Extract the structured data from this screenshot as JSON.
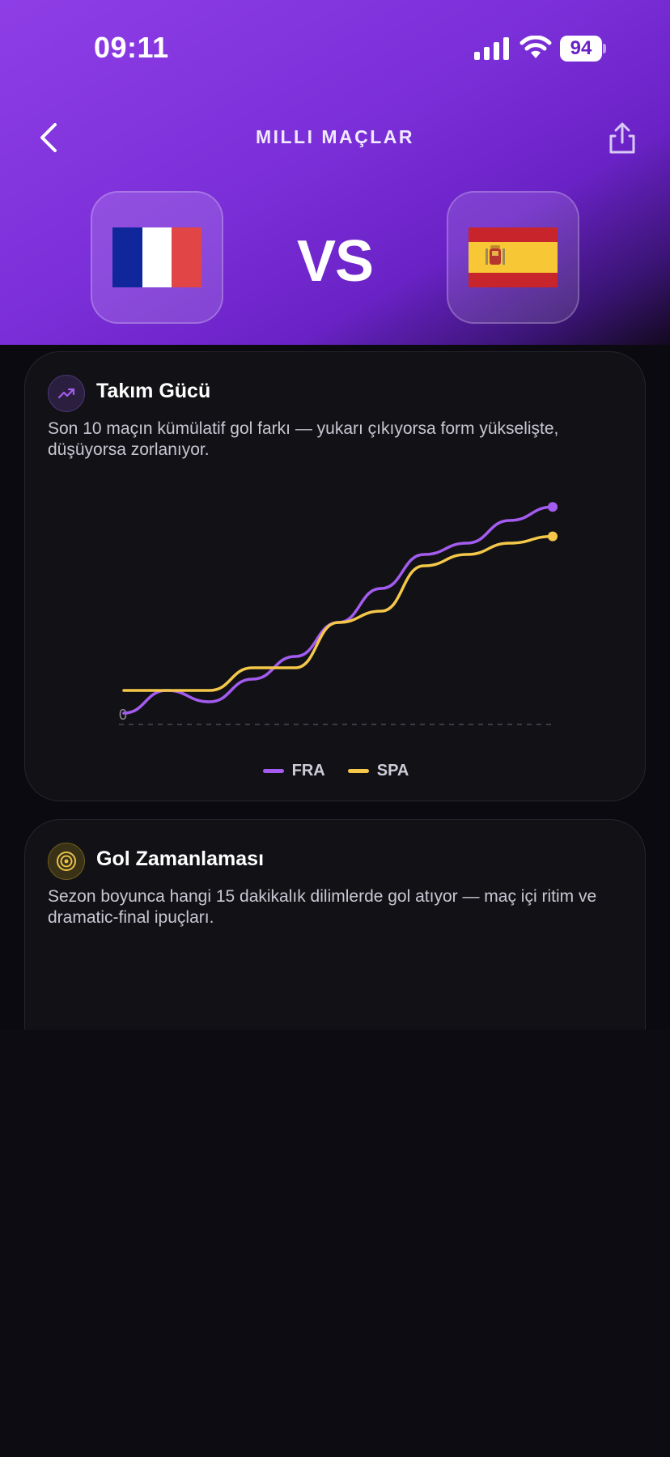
{
  "status_bar": {
    "time": "09:11",
    "battery": "94",
    "icons": [
      "cellular-signal-icon",
      "wifi-icon",
      "battery-icon"
    ]
  },
  "header": {
    "title": "MILLI MAÇLAR",
    "back_icon": "chevron-left-icon",
    "share_icon": "share-icon",
    "vs_label": "VS",
    "home_team_flag": "france-flag",
    "away_team_flag": "spain-flag",
    "gradient_colors": [
      "#8f3ee6",
      "#6a22c6",
      "#13091f"
    ]
  },
  "strength_card": {
    "icon": "trending-up-icon",
    "title": "Takım Gücü",
    "description": "Son 10 maçın kümülatif gol farkı — yukarı çıkıyorsa form yükselişte, düşüyorsa zorlanıyor."
  },
  "chart_data": {
    "type": "line",
    "title": "",
    "xlabel": "",
    "ylabel": "",
    "x": [
      0,
      1,
      2,
      3,
      4,
      5,
      6,
      7,
      8,
      9,
      10
    ],
    "ylim": [
      0,
      10
    ],
    "baseline_label": "0",
    "baseline_style": "dashed",
    "grid": false,
    "legend_position": "bottom-center",
    "series": [
      {
        "name": "FRA",
        "color": "#a45cf0",
        "values": [
          0,
          1,
          0.5,
          1.5,
          2.5,
          4,
          5.5,
          7,
          7.5,
          8.5,
          9.1
        ]
      },
      {
        "name": "SPA",
        "color": "#f5c84a",
        "values": [
          1,
          1,
          1,
          2,
          2,
          4,
          4.5,
          6.5,
          7,
          7.5,
          7.8
        ]
      }
    ]
  },
  "goals_card": {
    "icon": "target-icon",
    "title": "Gol Zamanlaması",
    "description": "Sezon boyunca hangi 15 dakikalık dilimlerde gol atıyor — maç içi ritim ve dramatic-final ipuçları."
  }
}
